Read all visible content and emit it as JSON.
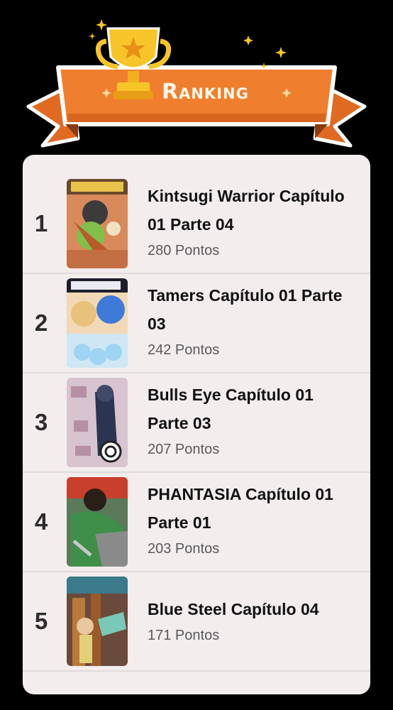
{
  "header": {
    "title": "Ranking",
    "trophy_icon": "trophy-icon",
    "colors": {
      "ribbon": "#ef7f2e",
      "ribbon_dark": "#c85a18",
      "gold": "#f7c52a"
    }
  },
  "ranking": [
    {
      "rank": "1",
      "title": "Kintsugi Warrior Capítulo 01 Parte 04",
      "points": "280 Pontos"
    },
    {
      "rank": "2",
      "title": "Tamers Capítulo 01 Parte 03",
      "points": "242 Pontos"
    },
    {
      "rank": "3",
      "title": "Bulls Eye Capítulo 01 Parte 03",
      "points": "207 Pontos"
    },
    {
      "rank": "4",
      "title": "PHANTASIA Capítulo 01 Parte 01",
      "points": "203 Pontos"
    },
    {
      "rank": "5",
      "title": "Blue Steel Capítulo 04",
      "points": "171 Pontos"
    }
  ]
}
